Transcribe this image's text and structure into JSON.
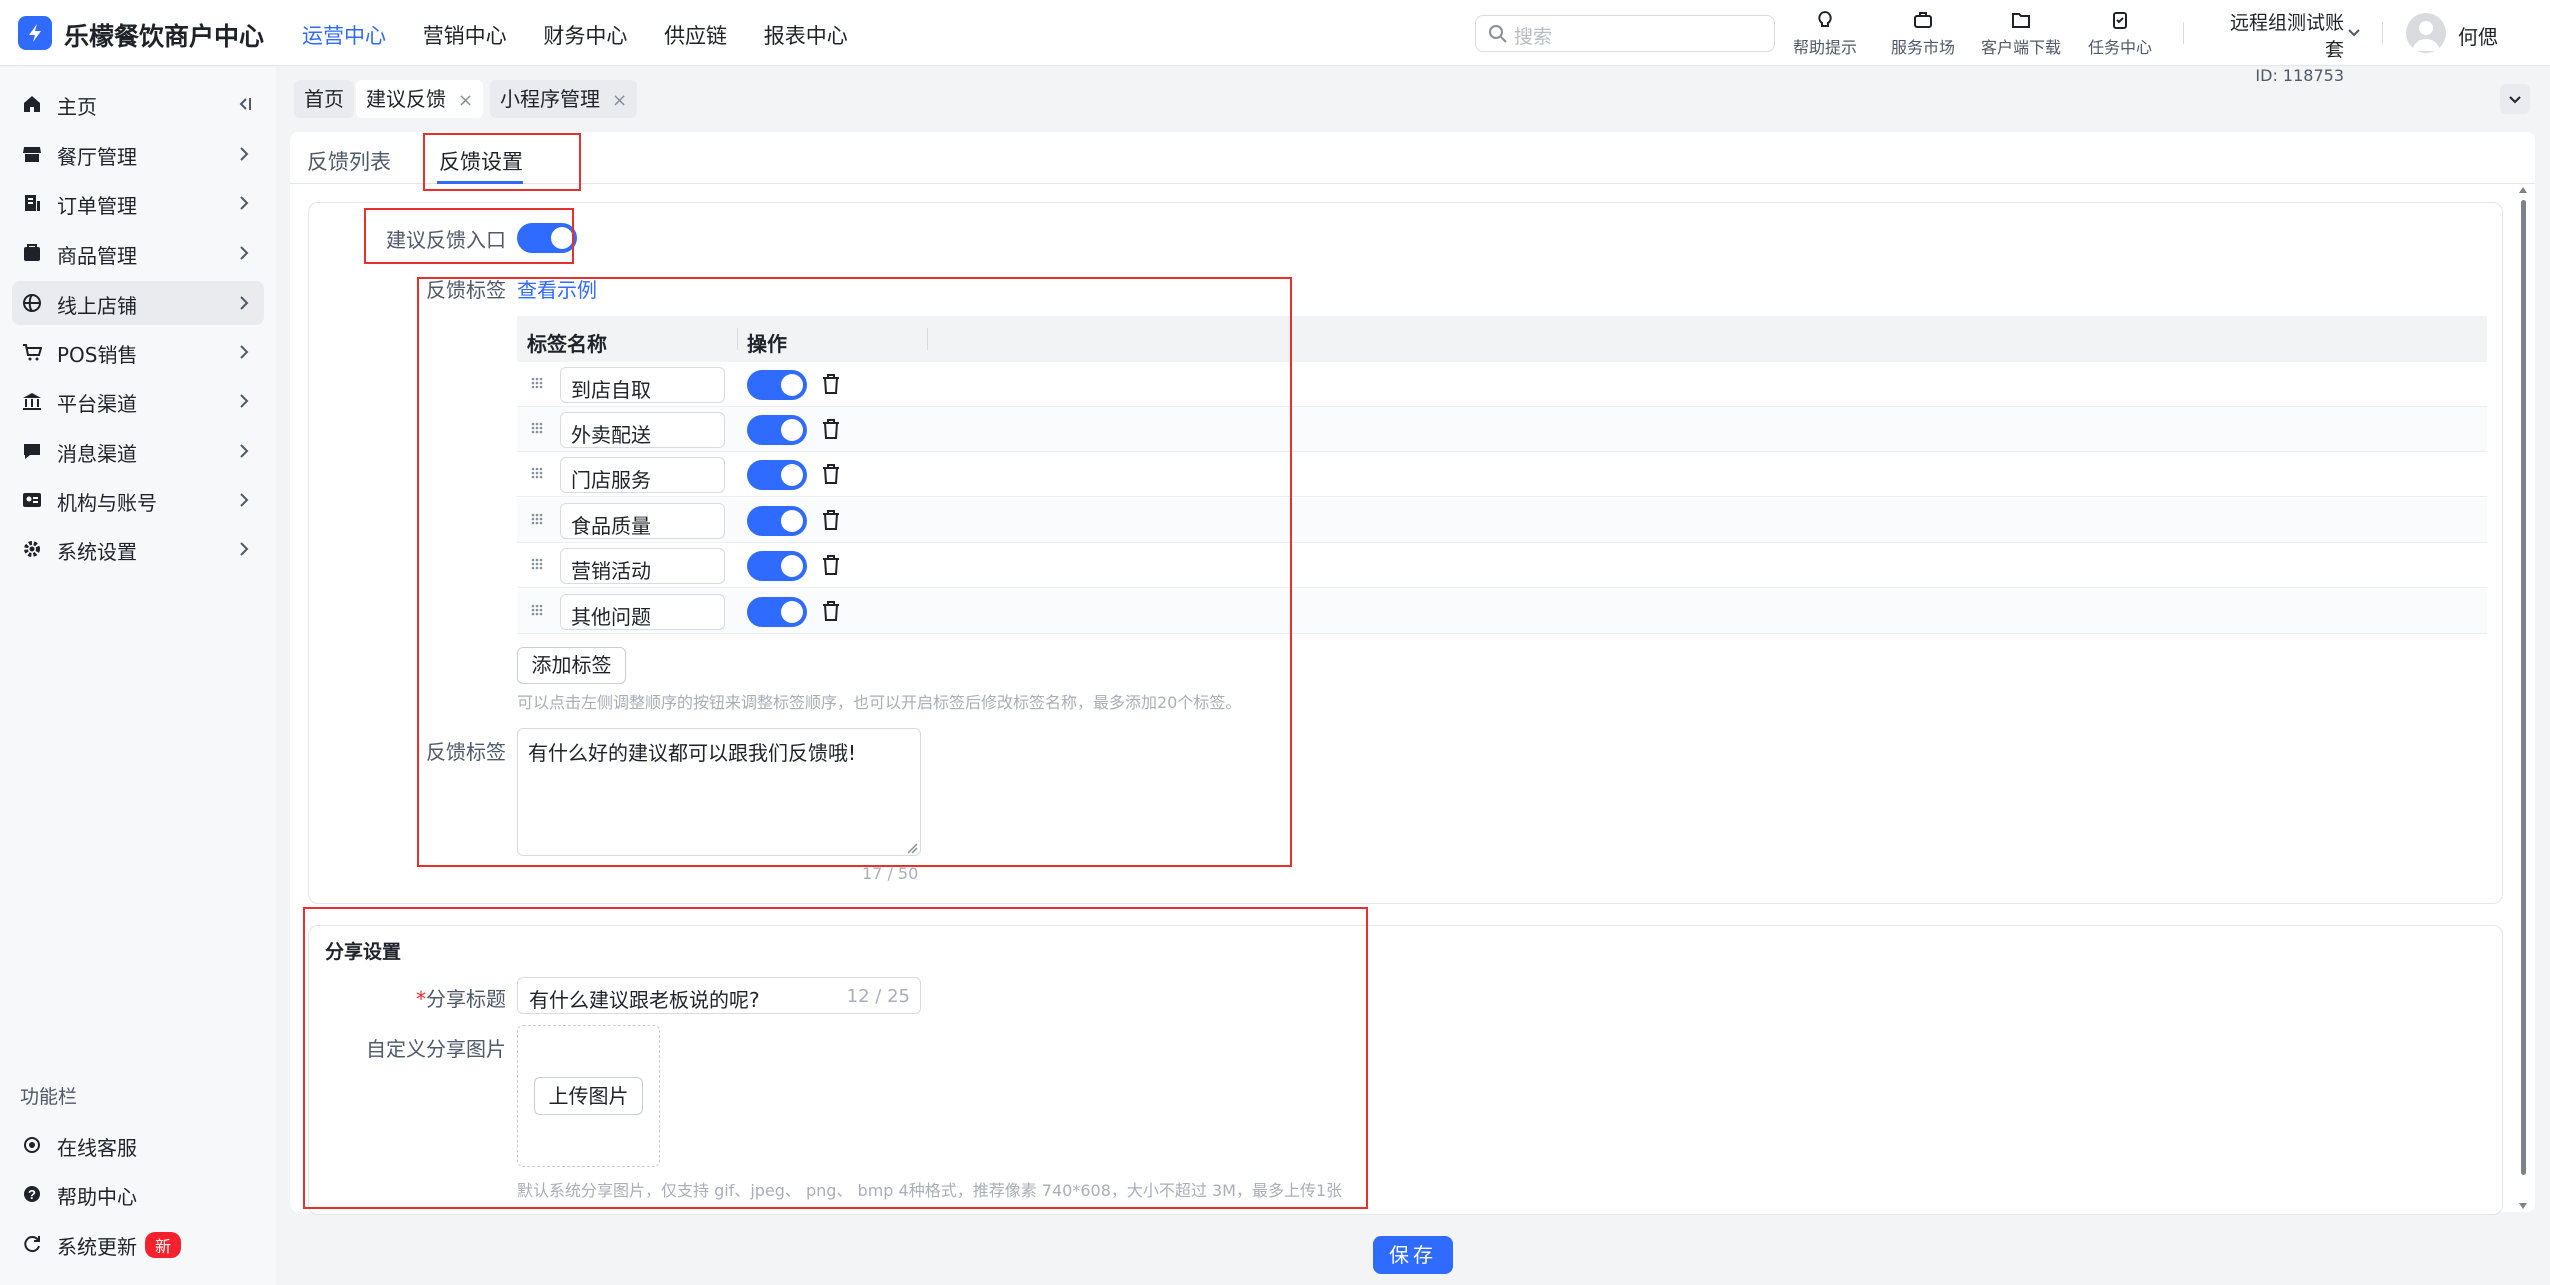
{
  "app": {
    "title": "乐檬餐饮商户中心"
  },
  "topnav": [
    "运营中心",
    "营销中心",
    "财务中心",
    "供应链",
    "报表中心"
  ],
  "search": {
    "placeholder": "搜索"
  },
  "tools": [
    "帮助提示",
    "服务市场",
    "客户端下载",
    "任务中心"
  ],
  "account": {
    "name": "远程组测试账套",
    "id": "ID: 118753"
  },
  "user": {
    "name": "何偲"
  },
  "sidebar": {
    "items": [
      {
        "label": "主页",
        "icon": "home-icon"
      },
      {
        "label": "餐厅管理",
        "icon": "store-icon"
      },
      {
        "label": "订单管理",
        "icon": "order-icon"
      },
      {
        "label": "商品管理",
        "icon": "goods-icon"
      },
      {
        "label": "线上店铺",
        "icon": "online-store-icon"
      },
      {
        "label": "POS销售",
        "icon": "cart-icon"
      },
      {
        "label": "平台渠道",
        "icon": "platform-icon"
      },
      {
        "label": "消息渠道",
        "icon": "message-icon"
      },
      {
        "label": "机构与账号",
        "icon": "account-icon"
      },
      {
        "label": "系统设置",
        "icon": "gear-icon"
      }
    ],
    "section_title": "功能栏",
    "bottom": [
      {
        "label": "在线客服"
      },
      {
        "label": "帮助中心"
      },
      {
        "label": "系统更新",
        "badge": "新"
      }
    ]
  },
  "tabs": [
    {
      "label": "首页"
    },
    {
      "label": "建议反馈",
      "close": "×"
    },
    {
      "label": "小程序管理",
      "close": "×"
    }
  ],
  "subtabs": {
    "list": "反馈列表",
    "settings": "反馈设置"
  },
  "feedback": {
    "entry_label": "建议反馈入口",
    "entry_enabled": true,
    "tags_label": "反馈标签",
    "example_link": "查看示例",
    "table_headers": [
      "标签名称",
      "操作"
    ],
    "tags": [
      {
        "name": "到店自取",
        "enabled": true
      },
      {
        "name": "外卖配送",
        "enabled": true
      },
      {
        "name": "门店服务",
        "enabled": true
      },
      {
        "name": "食品质量",
        "enabled": true
      },
      {
        "name": "营销活动",
        "enabled": true
      },
      {
        "name": "其他问题",
        "enabled": true
      }
    ],
    "add_tag_button": "添加标签",
    "tags_hint": "可以点击左侧调整顺序的按钮来调整标签顺序，也可以开启标签后修改标签名称，最多添加20个标签。",
    "prompt_label": "反馈标签",
    "prompt_value": "有什么好的建议都可以跟我们反馈哦!",
    "prompt_count": "17 / 50"
  },
  "share": {
    "section_title": "分享设置",
    "required_mark": "*",
    "title_label": "分享标题",
    "title_value": "有什么建议跟老板说的呢?",
    "title_count": "12 / 25",
    "image_label": "自定义分享图片",
    "upload_button": "上传图片",
    "image_hint": "默认系统分享图片，仅支持 gif、jpeg、 png、 bmp 4种格式，推荐像素 740*608，大小不超过 3M，最多上传1张"
  },
  "save_button": "保存",
  "colors": {
    "accent": "#2f6bff",
    "highlight": "#e6312e",
    "badge": "#f5222d"
  }
}
